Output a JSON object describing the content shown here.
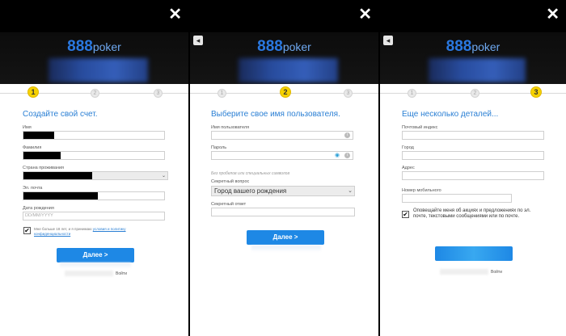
{
  "panels": [
    {
      "close_icon": "✕",
      "logo_number": "888",
      "logo_word": "poker",
      "steps": [
        "1",
        "2",
        "3"
      ],
      "active_step": "1",
      "title": "Создайте свой счет.",
      "fields": {
        "first_name": "Имя",
        "last_name": "Фамилия",
        "country": "Страна проживания",
        "email": "Эл. почта",
        "birthdate": "Дата рождения",
        "birthdate_placeholder": "DD/MM/YYYY"
      },
      "terms_text": "Мне больше 18 лет, и я принимаю",
      "terms_link": "условия и политику конфиденциальности",
      "next_button": "Далее >",
      "footer_right": "Войти"
    },
    {
      "close_icon": "✕",
      "back_icon": "◂",
      "logo_number": "888",
      "logo_word": "poker",
      "steps": [
        "1",
        "2",
        "3"
      ],
      "active_step": "2",
      "title": "Выберите свое имя пользователя.",
      "fields": {
        "username": "Имя пользователя",
        "password": "Пароль",
        "hint": "Без пробелов или специальных символов",
        "secret_question": "Секретный вопрос",
        "secret_question_value": "Город вашего рождения",
        "secret_answer": "Секретный ответ"
      },
      "next_button": "Далее >"
    },
    {
      "close_icon": "✕",
      "back_icon": "◂",
      "logo_number": "888",
      "logo_word": "poker",
      "steps": [
        "1",
        "2",
        "3"
      ],
      "active_step": "3",
      "title": "Еще несколько деталей...",
      "fields": {
        "postcode": "Почтовый индекс",
        "city": "Город",
        "address": "Адрес",
        "mobile": "Номер мобильного"
      },
      "notify_text": "Оповещайте меня об акциях и предложениях по эл. почте, текстовыми сообщениями или по почте.",
      "footer_right": "Войти"
    }
  ],
  "colors": {
    "accent": "#2a7fd4",
    "button": "#1e88e5",
    "active_step": "#f6d200"
  }
}
